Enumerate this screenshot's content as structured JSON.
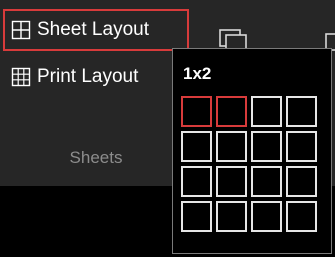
{
  "ribbon": {
    "sheet_layout": {
      "label": "Sheet Layout",
      "icon": "sheet-layout-icon"
    },
    "print_layout": {
      "label": "Print Layout",
      "icon": "print-layout-icon"
    },
    "group_label": "Sheets"
  },
  "layout_picker": {
    "selection_label": "1x2",
    "columns": 4,
    "rows": 4,
    "selected_rows": 1,
    "selected_columns": 2
  },
  "colors": {
    "ribbon_bg": "#262626",
    "highlight": "#d83b3b",
    "cell_border": "#e6e6e6",
    "group_label": "#8c8c8c"
  }
}
